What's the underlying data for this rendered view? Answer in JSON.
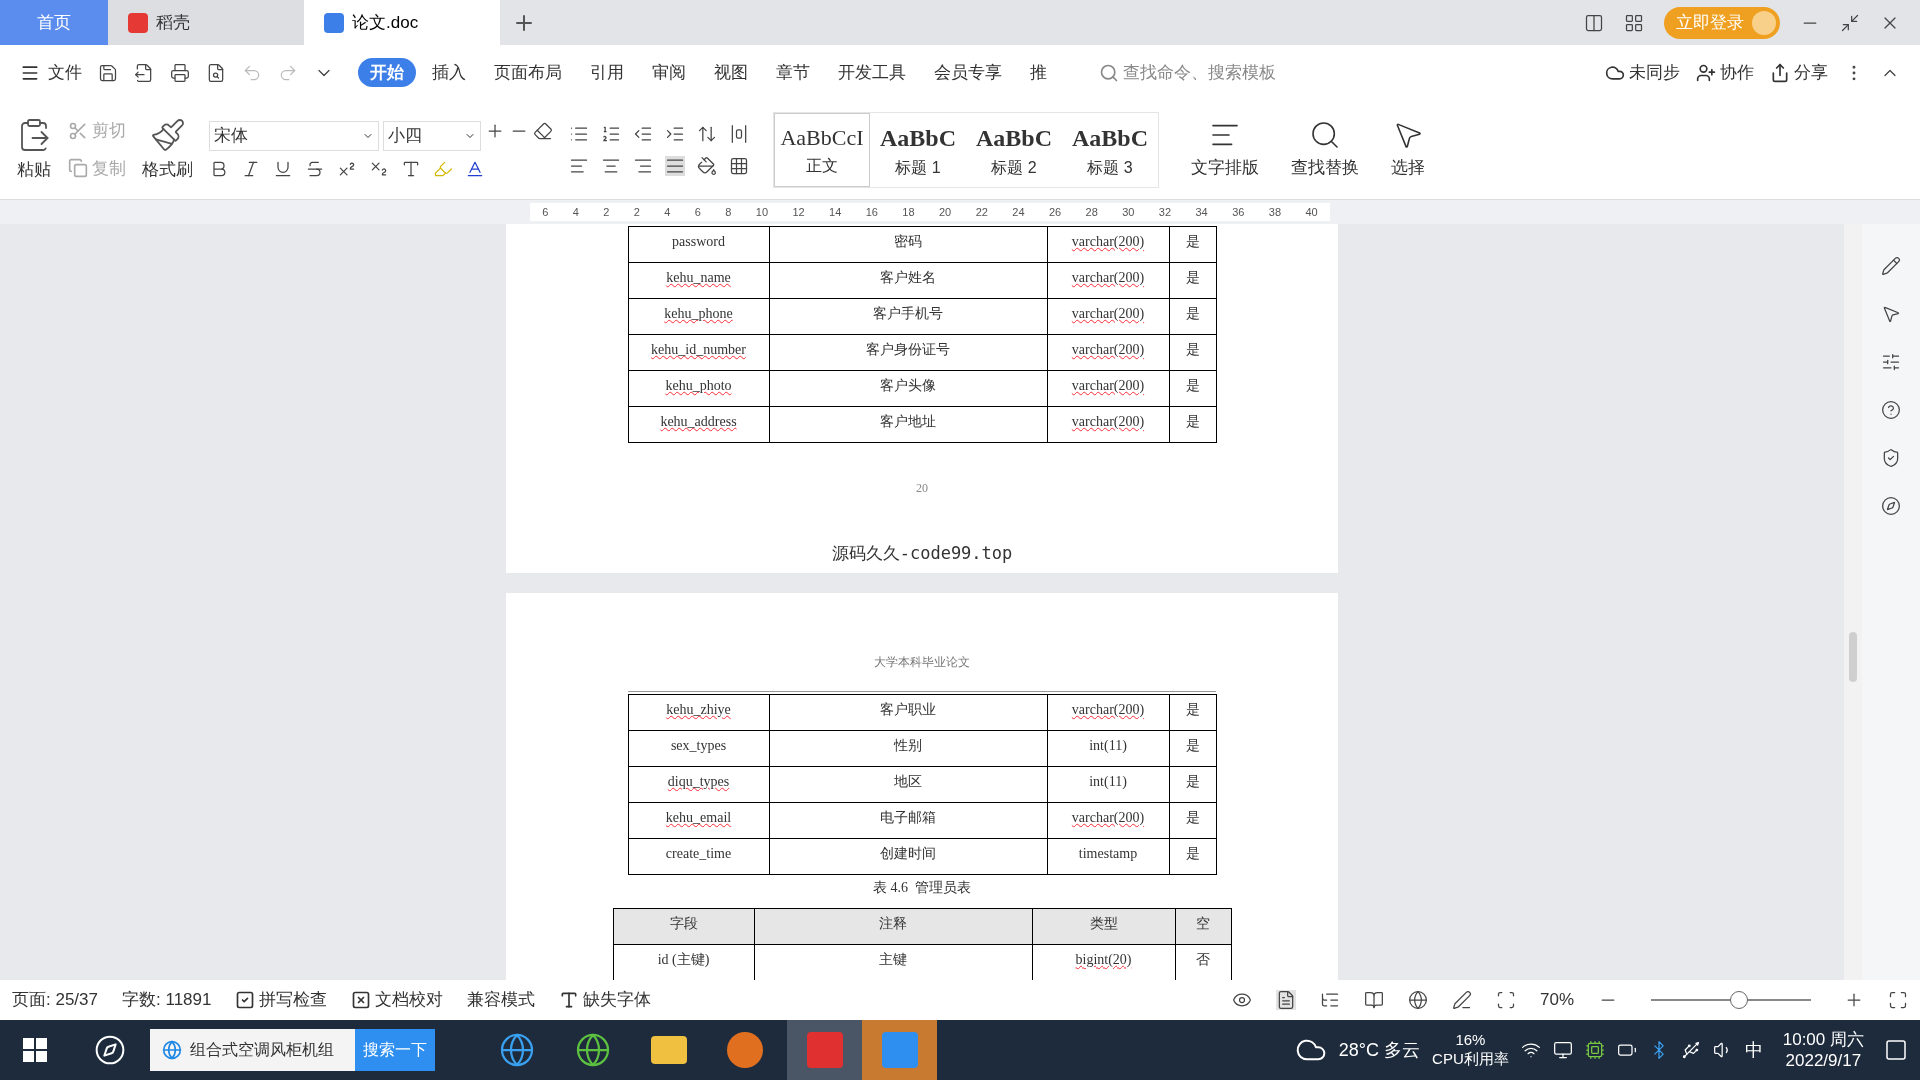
{
  "tabs": [
    {
      "label": "首页",
      "kind": "home",
      "selected": false
    },
    {
      "label": "稻壳",
      "kind": "app",
      "selected": false
    },
    {
      "label": "论文.doc",
      "kind": "doc",
      "selected": true
    }
  ],
  "title_bar": {
    "login": "立即登录"
  },
  "menu": {
    "file": "文件",
    "tabs": [
      {
        "label": "开始",
        "selected": true
      },
      {
        "label": "插入",
        "selected": false
      },
      {
        "label": "页面布局",
        "selected": false
      },
      {
        "label": "引用",
        "selected": false
      },
      {
        "label": "审阅",
        "selected": false
      },
      {
        "label": "视图",
        "selected": false
      },
      {
        "label": "章节",
        "selected": false
      },
      {
        "label": "开发工具",
        "selected": false
      },
      {
        "label": "会员专享",
        "selected": false
      },
      {
        "label": "推",
        "selected": false
      }
    ],
    "search": {
      "placeholder": "查找命令、搜索模板"
    },
    "actions": [
      "未同步",
      "协作",
      "分享"
    ]
  },
  "ribbon": {
    "paste": "粘贴",
    "cut": "剪切",
    "copy": "复制",
    "format_painter": "格式刷",
    "font": "宋体",
    "size": "小四",
    "styles": [
      {
        "preview": "AaBbCcI",
        "label": "正文",
        "selected": true
      },
      {
        "preview": "AaBbC",
        "label": "标题 1",
        "selected": false
      },
      {
        "preview": "AaBbC",
        "label": "标题 2",
        "selected": false
      },
      {
        "preview": "AaBbC",
        "label": "标题 3",
        "selected": false
      }
    ],
    "tools": [
      "文字排版",
      "查找替换",
      "选择"
    ]
  },
  "ruler": [
    "6",
    "4",
    "2",
    "2",
    "4",
    "6",
    "8",
    "10",
    "12",
    "14",
    "16",
    "18",
    "20",
    "22",
    "24",
    "26",
    "28",
    "30",
    "32",
    "34",
    "36",
    "38",
    "40"
  ],
  "page1": {
    "rows": [
      {
        "field": "password",
        "comment": "密码",
        "type": "varchar(200)",
        "nullable": "是",
        "field_flagged": false,
        "type_flagged": true
      },
      {
        "field": "kehu_name",
        "comment": "客户姓名",
        "type": "varchar(200)",
        "nullable": "是",
        "field_flagged": true,
        "type_flagged": true
      },
      {
        "field": "kehu_phone",
        "comment": "客户手机号",
        "type": "varchar(200)",
        "nullable": "是",
        "field_flagged": true,
        "type_flagged": true
      },
      {
        "field": "kehu_id_number",
        "comment": "客户身份证号",
        "type": "varchar(200)",
        "nullable": "是",
        "field_flagged": true,
        "type_flagged": true
      },
      {
        "field": "kehu_photo",
        "comment": "客户头像",
        "type": "varchar(200)",
        "nullable": "是",
        "field_flagged": true,
        "type_flagged": true
      },
      {
        "field": "kehu_address",
        "comment": "客户地址",
        "type": "varchar(200)",
        "nullable": "是",
        "field_flagged": true,
        "type_flagged": true
      }
    ],
    "page_number": "20",
    "footer": "源码久久-code99.top"
  },
  "page2": {
    "header": "大学本科毕业论文",
    "rows": [
      {
        "field": "kehu_zhiye",
        "comment": "客户职业",
        "type": "varchar(200)",
        "nullable": "是",
        "field_flagged": true,
        "type_flagged": true
      },
      {
        "field": "sex_types",
        "comment": "性别",
        "type": "int(11)",
        "nullable": "是",
        "field_flagged": false,
        "type_flagged": false
      },
      {
        "field": "diqu_types",
        "comment": "地区",
        "type": "int(11)",
        "nullable": "是",
        "field_flagged": true,
        "type_flagged": false
      },
      {
        "field": "kehu_email",
        "comment": "电子邮箱",
        "type": "varchar(200)",
        "nullable": "是",
        "field_flagged": true,
        "type_flagged": true
      },
      {
        "field": "create_time",
        "comment": "创建时间",
        "type": "timestamp",
        "nullable": "是",
        "field_flagged": false,
        "type_flagged": false
      }
    ],
    "caption": "表 4.6  管理员表",
    "columns": [
      "字段",
      "注释",
      "类型",
      "空"
    ],
    "rows2": [
      {
        "field": "id (主键)",
        "comment": "主键",
        "type": "bigint(20)",
        "nullable": "否",
        "field_flagged": false,
        "type_flagged": true
      }
    ]
  },
  "status_bar": {
    "page": "页面: 25/37",
    "words": "字数: 11891",
    "spell": "拼写检查",
    "proof": "文档校对",
    "compat": "兼容模式",
    "fonts": "缺失字体",
    "zoom": "70%",
    "zoom_slider": {
      "level": 0.55
    }
  },
  "taskbar": {
    "search": "组合式空调风柜机组",
    "search_button": "搜索一下",
    "weather": "28°C 多云",
    "cpu": "16%",
    "cpu_label": "CPU利用率",
    "ime": "中",
    "time": "10:00 周六",
    "date": "2022/9/17"
  }
}
